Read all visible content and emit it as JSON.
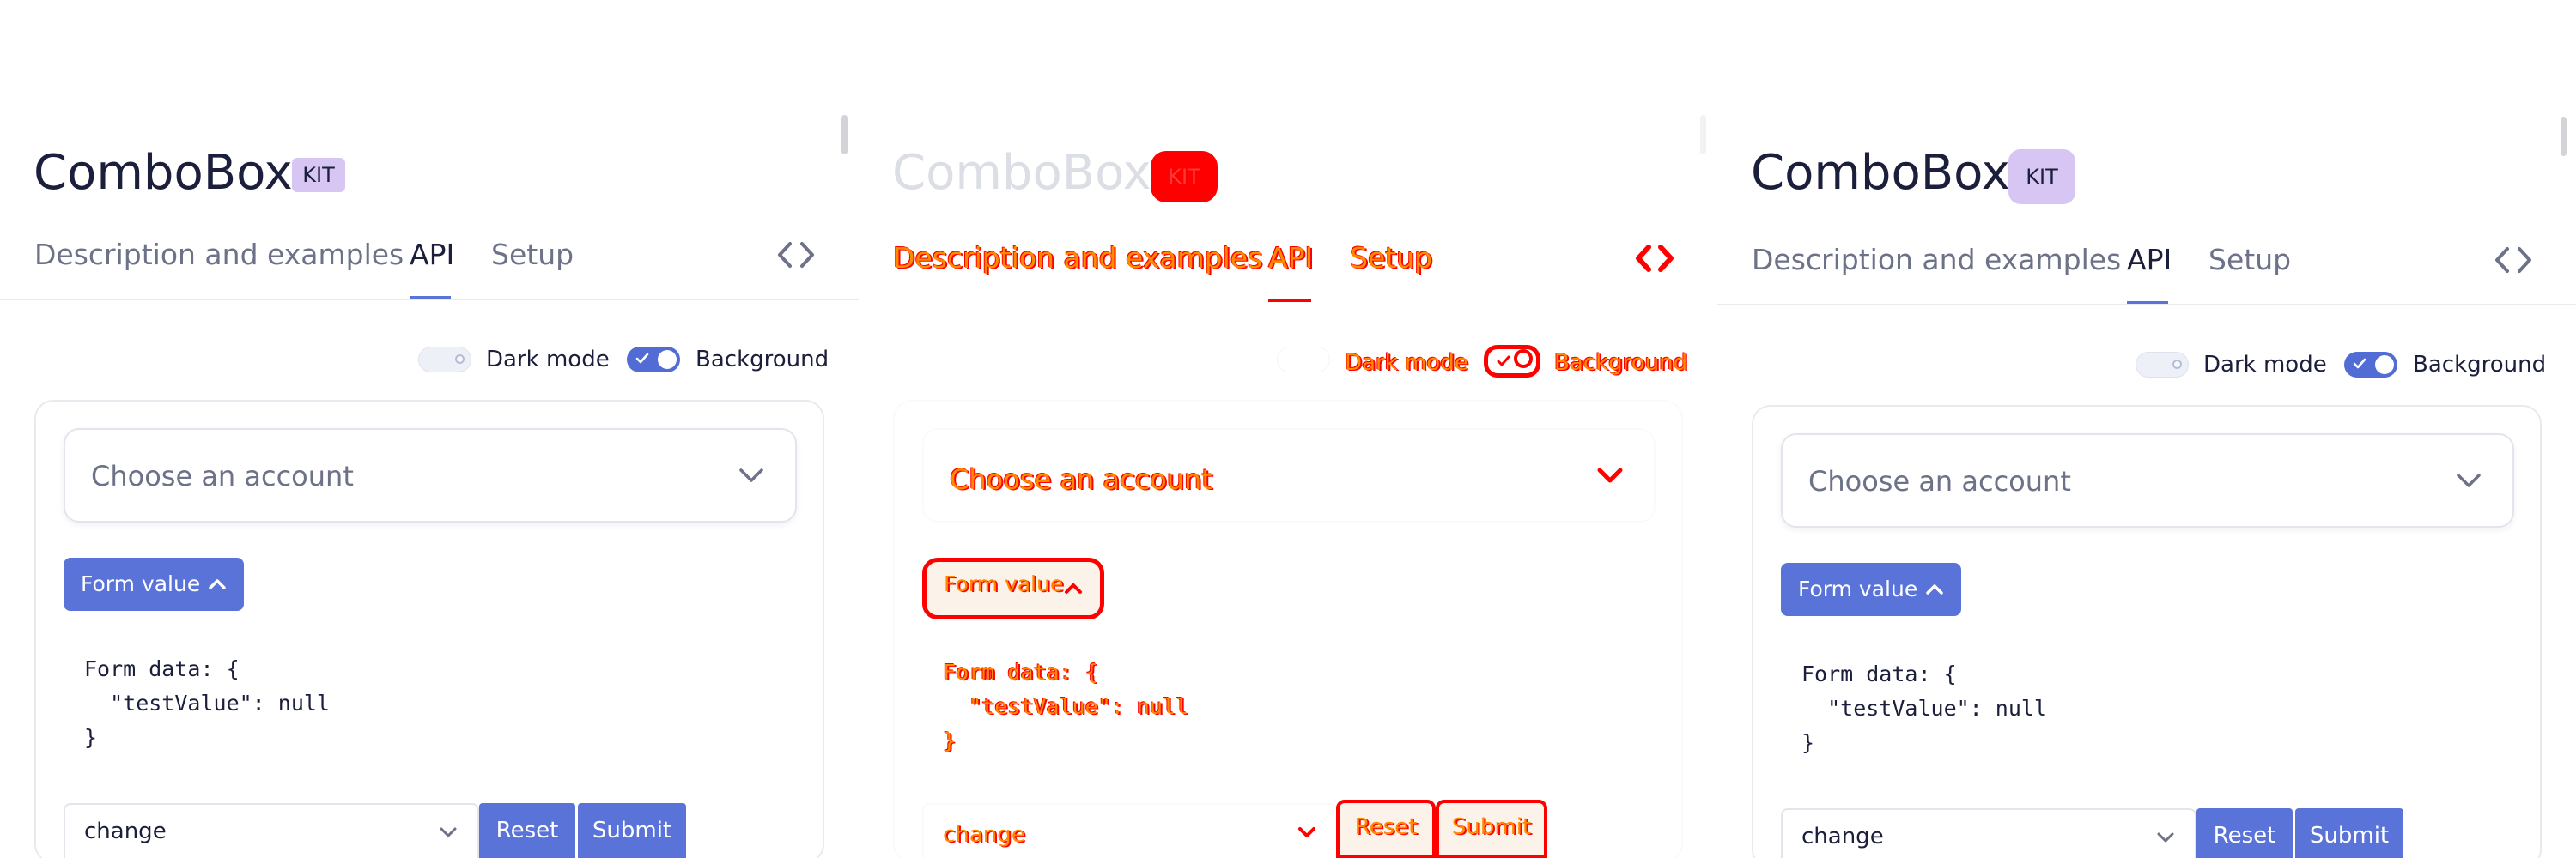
{
  "colors": {
    "accent": "#5a73d8",
    "kit_badge": "#d7c6f3",
    "text": "#1b1f3b",
    "muted_text": "#6c7287",
    "diff_fill": "#ff8a00",
    "diff_outline": "#ff0000"
  },
  "icons": {
    "code": "code-brackets-icon",
    "combo_chevron": "chevron-down-icon",
    "form_value_chevron": "chevron-up-icon",
    "select_chevron": "chevron-down-icon",
    "toggle_check": "check-icon"
  },
  "page": {
    "title": "ComboBox",
    "badge": "KIT"
  },
  "tabs": [
    {
      "label": "Description and examples",
      "active": false
    },
    {
      "label": "API",
      "active": true
    },
    {
      "label": "Setup",
      "active": false
    }
  ],
  "toggles": {
    "dark_mode": {
      "label": "Dark mode",
      "on": false
    },
    "background": {
      "label": "Background",
      "on": true
    }
  },
  "demo": {
    "combobox_placeholder": "Choose an account",
    "form_value_label": "Form value",
    "form_data": {
      "line1": "Form data: {",
      "line2": "  \"testValue\": null",
      "line3": "}"
    },
    "event_select_value": "change",
    "reset_label": "Reset",
    "submit_label": "Submit"
  }
}
